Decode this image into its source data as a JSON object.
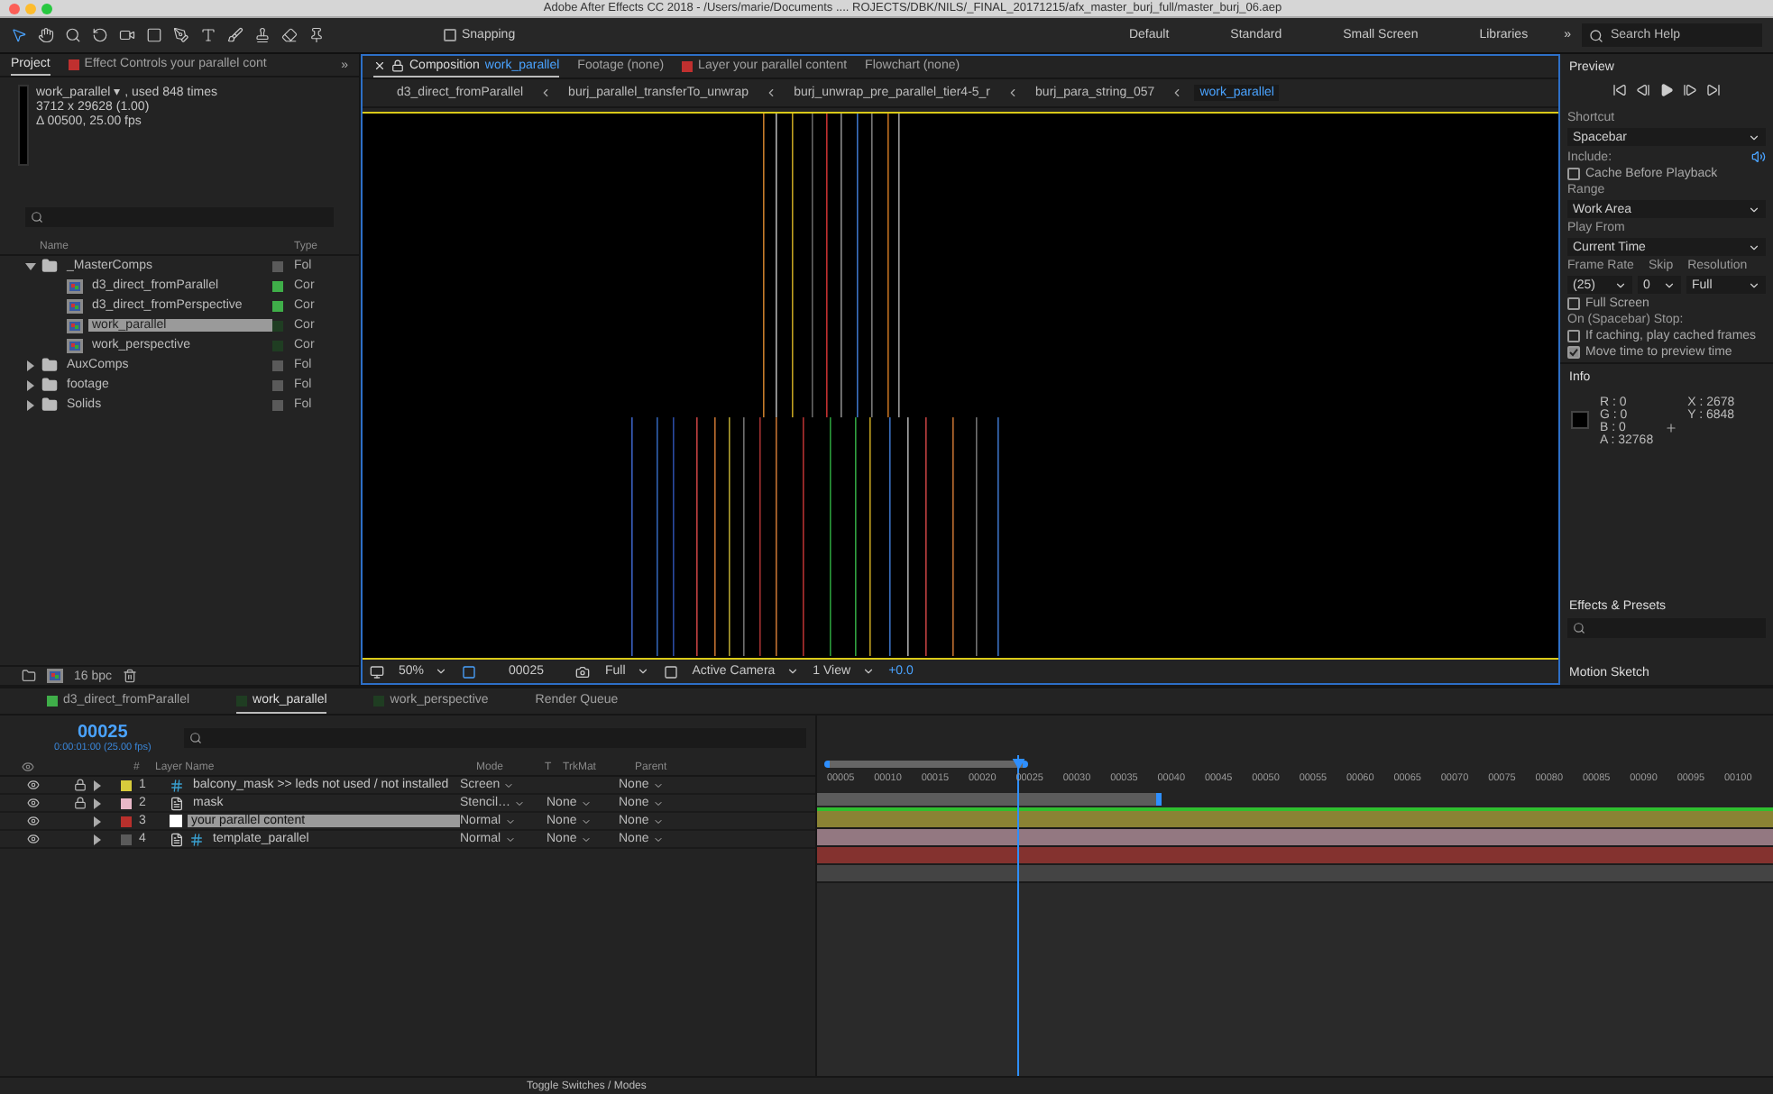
{
  "app_title": "Adobe After Effects CC 2018 - /Users/marie/Documents .... ROJECTS/DBK/NILS/_FINAL_20171215/afx_master_burj_full/master_burj_06.aep",
  "toolbar": {
    "snapping": {
      "label": "Snapping",
      "checked": false
    },
    "workspaces": [
      "Default",
      "Standard",
      "Small Screen",
      "Libraries"
    ],
    "overflow": "»",
    "search": {
      "placeholder": "Search Help"
    }
  },
  "project": {
    "tabs": [
      {
        "label": "Project",
        "selected": true
      },
      {
        "label": "Effect Controls your parallel cont",
        "color": "#c0302f",
        "selected": false
      }
    ],
    "overflow": "»",
    "summary": [
      "work_parallel ▾ , used 848 times",
      "3712 x 29628 (1.00)",
      "Δ 00500, 25.00 fps"
    ],
    "columns": [
      "Name",
      "Type"
    ],
    "items": [
      {
        "name": "_MasterComps",
        "type": "Fol",
        "kind": "folder",
        "color": "#5a5a5a",
        "expanded": true,
        "selected": false,
        "children": [
          {
            "name": "d3_direct_fromParallel",
            "type": "Cor",
            "kind": "comp",
            "color": "#3fae49",
            "selected": false
          },
          {
            "name": "d3_direct_fromPerspective",
            "type": "Cor",
            "kind": "comp",
            "color": "#3fae49",
            "selected": false
          },
          {
            "name": "work_parallel",
            "type": "Cor",
            "kind": "comp",
            "color": "#1f3d22",
            "selected": true
          },
          {
            "name": "work_perspective",
            "type": "Cor",
            "kind": "comp",
            "color": "#1f3d22",
            "selected": false
          }
        ]
      },
      {
        "name": "AuxComps",
        "type": "Fol",
        "kind": "folder",
        "color": "#5a5a5a",
        "expanded": false,
        "selected": false
      },
      {
        "name": "footage",
        "type": "Fol",
        "kind": "folder",
        "color": "#5a5a5a",
        "expanded": false,
        "selected": false
      },
      {
        "name": "Solids",
        "type": "Fol",
        "kind": "folder",
        "color": "#5a5a5a",
        "expanded": false,
        "selected": false
      }
    ],
    "bpc": "16 bpc"
  },
  "composition": {
    "tabs": [
      {
        "label": "Composition",
        "name": "work_parallel",
        "selected": true
      },
      {
        "label": "Footage (none)",
        "selected": false
      },
      {
        "label": "Layer your parallel content",
        "color": "#c0302f",
        "selected": false
      },
      {
        "label": "Flowchart (none)",
        "selected": false
      }
    ],
    "breadcrumbs": [
      {
        "label": "d3_direct_fromParallel",
        "selected": false
      },
      {
        "label": "burj_parallel_transferTo_unwrap",
        "selected": false
      },
      {
        "label": "burj_unwrap_pre_parallel_tier4-5_r",
        "selected": false
      },
      {
        "label": "burj_para_string_057",
        "selected": false
      },
      {
        "label": "work_parallel",
        "selected": true
      }
    ],
    "viewer_bar": {
      "zoom": "50%",
      "time": "00025",
      "resolution": "Full",
      "camera": "Active Camera",
      "views": "1 View",
      "exposure": "+0.0"
    }
  },
  "preview": {
    "title": "Preview",
    "shortcut_label": "Shortcut",
    "shortcut": "Spacebar",
    "include_label": "Include:",
    "cache": {
      "label": "Cache Before Playback",
      "checked": false
    },
    "range_label": "Range",
    "range": "Work Area",
    "play_from_label": "Play From",
    "play_from": "Current Time",
    "frame_rate_label": "Frame Rate",
    "skip_label": "Skip",
    "resolution_label": "Resolution",
    "frame_rate": "(25)",
    "skip": "0",
    "resolution": "Full",
    "full_screen": {
      "label": "Full Screen",
      "checked": false
    },
    "stop_label": "On (Spacebar) Stop:",
    "stop_options": [
      {
        "label": "If caching, play cached frames",
        "checked": false
      },
      {
        "label": "Move time to preview time",
        "checked": true
      }
    ]
  },
  "info": {
    "title": "Info",
    "channels": [
      "R : 0",
      "G : 0",
      "B : 0",
      "A : 32768"
    ],
    "coords": [
      "X : 2678",
      "Y : 6848"
    ]
  },
  "effects": {
    "title": "Effects & Presets"
  },
  "motion_sketch": {
    "title": "Motion Sketch"
  },
  "timeline": {
    "tabs": [
      {
        "label": "d3_direct_fromParallel",
        "color": "#3fae49",
        "selected": false
      },
      {
        "label": "work_parallel",
        "color": "#1f3d22",
        "selected": true
      },
      {
        "label": "work_perspective",
        "color": "#1f3d22",
        "selected": false
      },
      {
        "label": "Render Queue",
        "selected": false
      }
    ],
    "timecode": "00025",
    "timecode_detail": "0:00:01:00 (25.00 fps)",
    "columns": {
      "number": "#",
      "layer_name": "Layer Name",
      "mode": "Mode",
      "t": "T",
      "trkmat": "TrkMat",
      "parent": "Parent"
    },
    "layers": [
      {
        "number": "1",
        "name": "balcony_mask >> leds not used / not installed",
        "kind": "shape",
        "color": "#d8cc3c",
        "locked": true,
        "selected": false,
        "mode": "Screen",
        "parent": "None"
      },
      {
        "number": "2",
        "name": "mask",
        "kind": "footage",
        "color": "#e8b8c8",
        "locked": true,
        "selected": false,
        "mode": "Stencil…",
        "trkmat": "None",
        "parent": "None"
      },
      {
        "number": "3",
        "name": "your parallel content",
        "kind": "solid",
        "color": "#b8302c",
        "locked": false,
        "selected": true,
        "mode": "Normal",
        "trkmat": "None",
        "parent": "None"
      },
      {
        "number": "4",
        "name": "template_parallel",
        "kind": "footage_shape",
        "color": "#5a5a5a",
        "locked": false,
        "selected": false,
        "mode": "Normal",
        "trkmat": "None",
        "parent": "None"
      }
    ],
    "ticks": [
      "00005",
      "00010",
      "00015",
      "00020",
      "00025",
      "00030",
      "00035",
      "00040",
      "00045",
      "00050",
      "00055",
      "00060",
      "00065",
      "00070",
      "00075",
      "00080",
      "00085",
      "00090",
      "00095",
      "00100"
    ],
    "playhead": {
      "level": 0.21
    },
    "work_area": {
      "level": 0.36
    },
    "toggle_label": "Toggle Switches / Modes"
  }
}
